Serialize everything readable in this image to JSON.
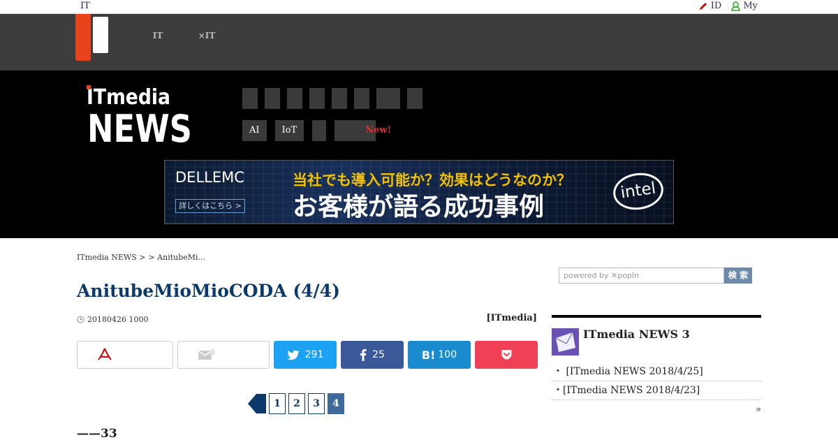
{
  "topbar": {
    "brand": "IT",
    "links": [
      {
        "icon": "pencil-icon",
        "label": "ID"
      },
      {
        "icon": "user-icon",
        "label": "My"
      }
    ]
  },
  "portal": {
    "tabs": [
      {
        "line1": "",
        "line2": "IT"
      },
      {
        "line1": "",
        "line2": "×IT"
      }
    ]
  },
  "header": {
    "logo_top": "ITmedia",
    "logo_bottom": "NEWS",
    "nav2": [
      {
        "label": "AI"
      },
      {
        "label": "IoT"
      },
      {
        "label": ""
      },
      {
        "label": "",
        "badge": "New!"
      }
    ]
  },
  "ad": {
    "brand": "DELLEMC",
    "more": "詳しくはこちら >",
    "line1": "当社でも導入可能か？効果はどうなのか？",
    "line2": "お客様が語る成功事例",
    "partner": "intel"
  },
  "breadcrumb": [
    "ITmedia NEWS >",
    " > AnitubeMi..."
  ],
  "article": {
    "title": "AnitubeMioMioCODA (4/4)",
    "date": "20180426 1000",
    "byline": "[ITmedia]",
    "subhead": "——33"
  },
  "share": {
    "twitter_count": "291",
    "facebook_count": "25",
    "hatena_label": "B!",
    "hatena_count": "100"
  },
  "pager": {
    "pages": [
      "1",
      "2",
      "3",
      "4"
    ],
    "current": "4"
  },
  "search": {
    "placeholder": "powered by ✕popIn",
    "button": "検 索"
  },
  "ranking": {
    "title": "ITmedia NEWS 3",
    "items": [
      "・ [ITmedia NEWS   2018/4/25]",
      "・[ITmedia NEWS   2018/4/23]"
    ],
    "more": "»"
  },
  "colors": {
    "accent_red": "#e8441b",
    "title_blue": "#0b3a6a",
    "twitter": "#1da1f2",
    "facebook": "#3b5998",
    "hatena": "#1b8bd0",
    "pocket": "#ef4056"
  }
}
